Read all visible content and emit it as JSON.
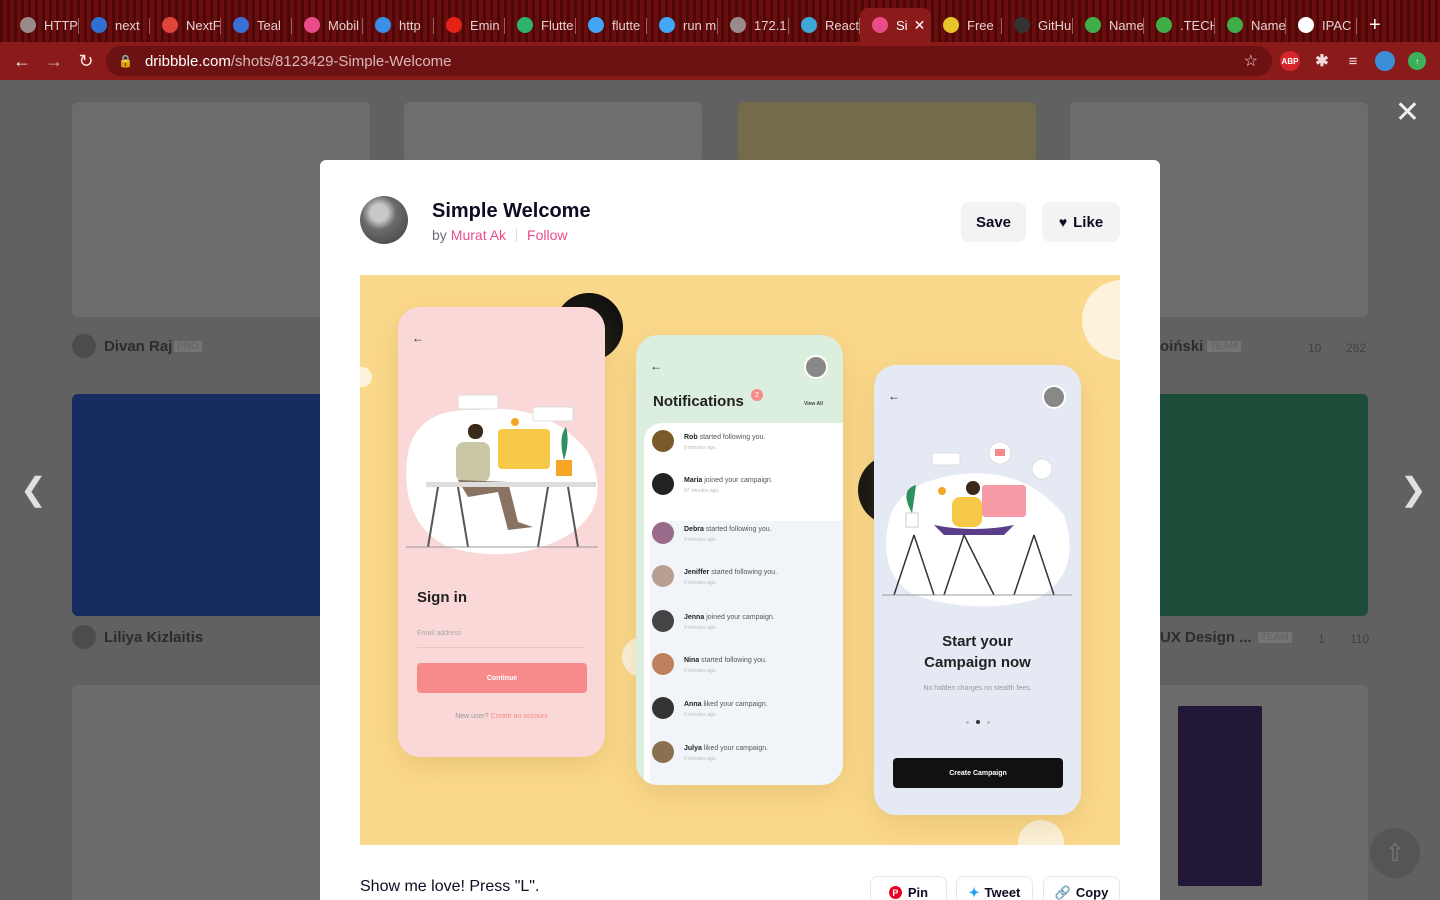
{
  "browser": {
    "tabs": [
      {
        "label": "HTTP",
        "icon": "globe-icon",
        "color": "#9a8a8a"
      },
      {
        "label": "next",
        "icon": "nextjs-icon",
        "color": "#2f6fd1"
      },
      {
        "label": "NextF",
        "icon": "figma-icon",
        "color": "#e0443b"
      },
      {
        "label": "Teal",
        "icon": "teal-icon",
        "color": "#3a6fd8"
      },
      {
        "label": "Mobil",
        "icon": "dribbble-icon",
        "color": "#ea4c89"
      },
      {
        "label": "http",
        "icon": "link-icon",
        "color": "#3a8ee6"
      },
      {
        "label": "Emin",
        "icon": "youtube-icon",
        "color": "#e62117"
      },
      {
        "label": "Flutte",
        "icon": "vector-icon",
        "color": "#2fb36b"
      },
      {
        "label": "flutte",
        "icon": "flutter-icon",
        "color": "#43a5f5"
      },
      {
        "label": "run m",
        "icon": "flutter-icon",
        "color": "#43a5f5"
      },
      {
        "label": "172.1",
        "icon": "globe-icon",
        "color": "#9a8a8a"
      },
      {
        "label": "React",
        "icon": "react-icon",
        "color": "#3fa7d6"
      },
      {
        "label": "Si",
        "icon": "dribbble-icon",
        "color": "#ea4c89",
        "active": true
      },
      {
        "label": "Free",
        "icon": "vs-icon",
        "color": "#e8c42a"
      },
      {
        "label": "GitHu",
        "icon": "github-icon",
        "color": "#333333"
      },
      {
        "label": "Name",
        "icon": "n-icon",
        "color": "#3fae49"
      },
      {
        "label": ".TECH",
        "icon": "dot-icon",
        "color": "#3fae49"
      },
      {
        "label": "Name",
        "icon": "n-icon",
        "color": "#3fae49"
      },
      {
        "label": "IPAC",
        "icon": "ipa-icon",
        "color": "#ffffff"
      }
    ],
    "new_tab": "+",
    "url_host": "dribbble.com",
    "url_path": "/shots/8123429-Simple-Welcome",
    "ext_abp": "ABP"
  },
  "background": {
    "cards": [
      {
        "name": "Divan Raj",
        "badge": "PRO"
      },
      {
        "name": "Liliya Kizlaitis",
        "badge": ""
      },
      {
        "name": "oiński",
        "badge": "TEAM",
        "comments": "10",
        "likes": "262"
      },
      {
        "name": "UX Design ...",
        "badge": "TEAM",
        "comments": "1",
        "likes": "110"
      }
    ]
  },
  "modal": {
    "title": "Simple Welcome",
    "by": "by",
    "author": "Murat Ak",
    "follow": "Follow",
    "save": "Save",
    "like": "Like",
    "love_prompt": "Show me love! Press \"L\".",
    "share": {
      "pin": "Pin",
      "tweet": "Tweet",
      "copy": "Copy"
    }
  },
  "shot": {
    "signin": {
      "title": "Sign in",
      "email_placeholder": "Email address",
      "continue": "Continue",
      "new_user": "New user?",
      "create_account": "Create an account"
    },
    "notifications": {
      "title": "Notifications",
      "badge": "2",
      "view_all": "View All",
      "items": [
        {
          "name": "Rob",
          "text": "started following you.",
          "time": "9 minutes ago."
        },
        {
          "name": "Maria",
          "text": "joined your campaign.",
          "time": "47 minutes ago."
        },
        {
          "name": "Debra",
          "text": "started following you.",
          "time": "9 minutes ago."
        },
        {
          "name": "Jeniffer",
          "text": "started following you.",
          "time": "9 minutes ago."
        },
        {
          "name": "Jenna",
          "text": "joined your campaign.",
          "time": "9 minutes ago."
        },
        {
          "name": "Nina",
          "text": "started following you.",
          "time": "9 minutes ago."
        },
        {
          "name": "Anna",
          "text": "liked your campaign.",
          "time": "9 minutes ago."
        },
        {
          "name": "Julya",
          "text": "liked your campaign.",
          "time": "9 minutes ago."
        }
      ]
    },
    "campaign": {
      "title_line1": "Start your",
      "title_line2": "Campaign now",
      "subtitle": "No hidden charges no stealth fees.",
      "button": "Create Campaign"
    }
  }
}
